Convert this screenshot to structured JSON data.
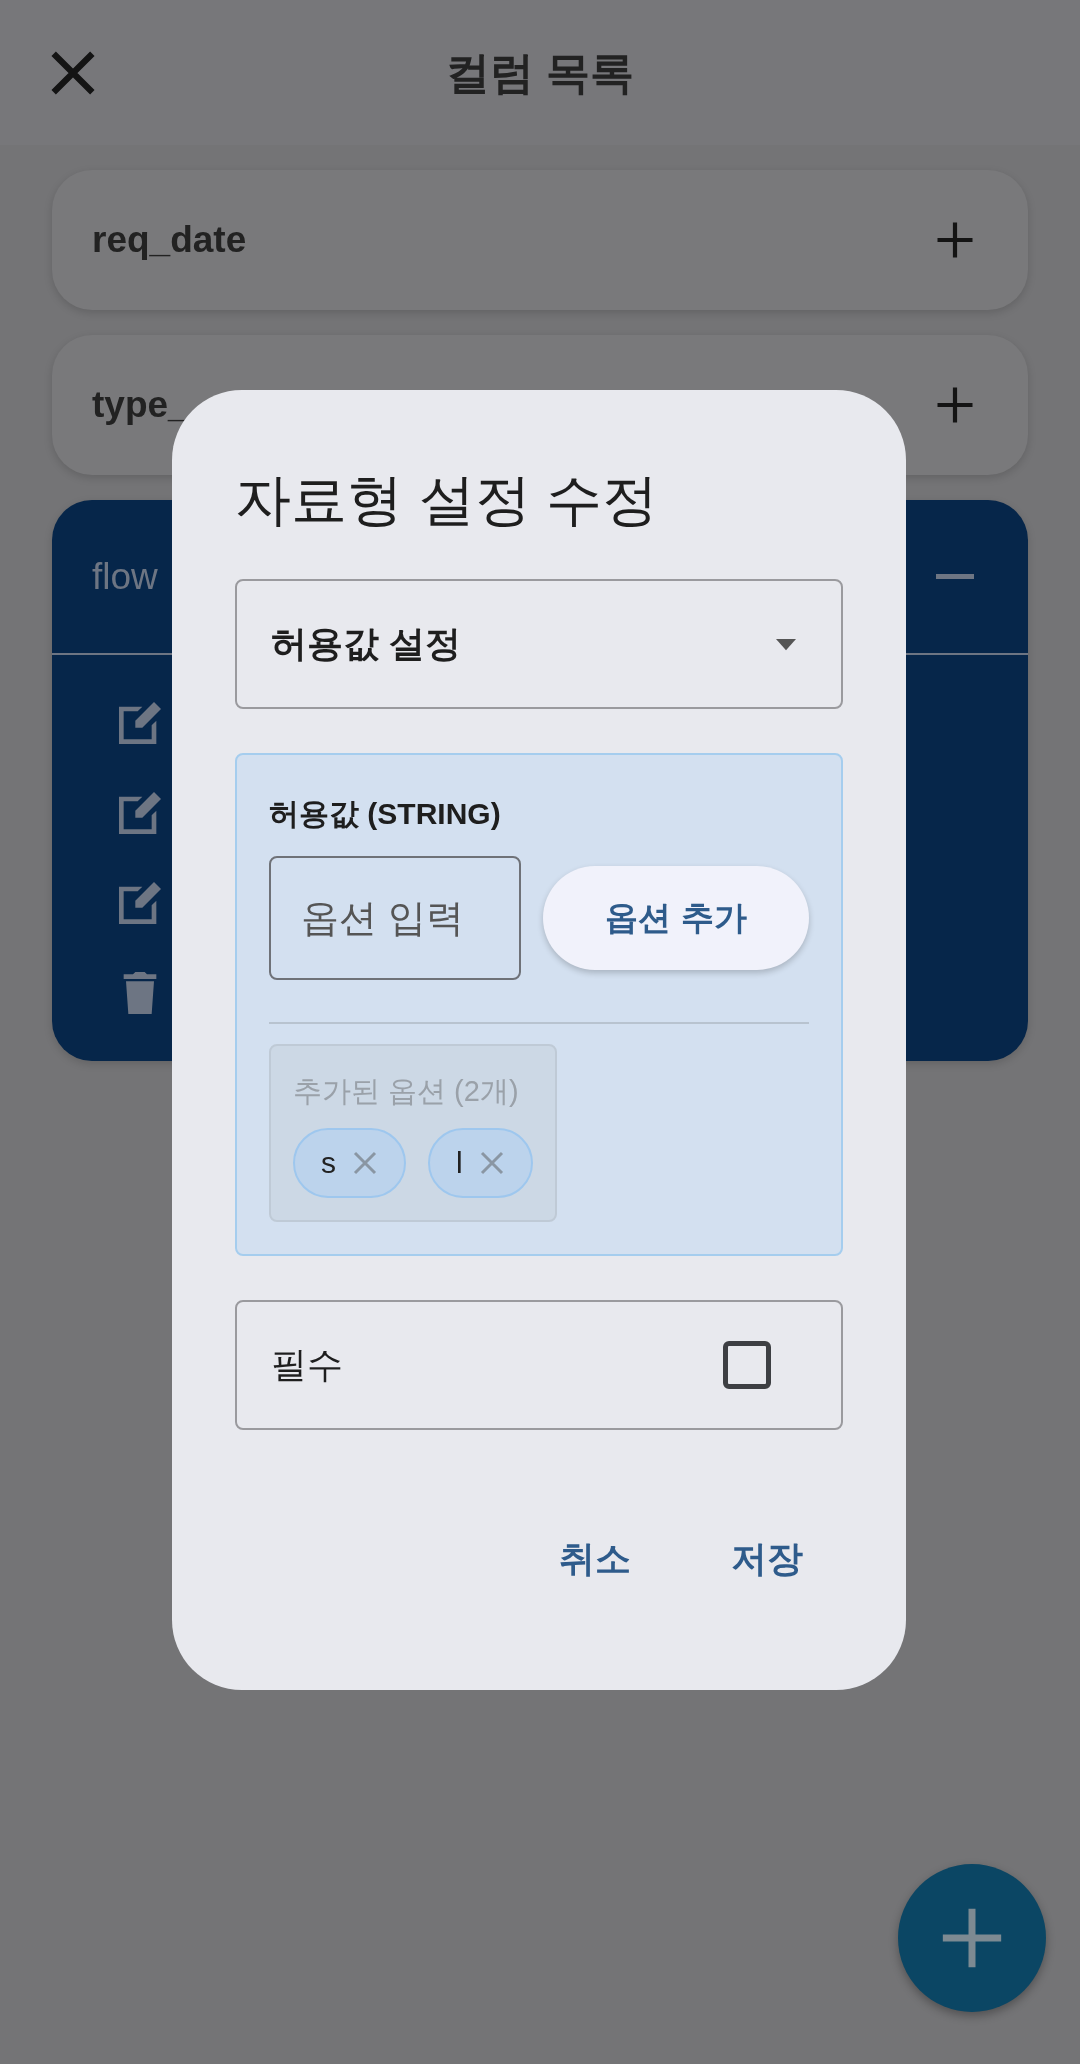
{
  "app_bar": {
    "title": "컬럼 목록"
  },
  "columns": [
    {
      "name": "req_date",
      "expanded": false
    },
    {
      "name": "type_",
      "expanded": false
    },
    {
      "name": "flow",
      "expanded": true,
      "actions": [
        {
          "kind": "edit"
        },
        {
          "kind": "edit"
        },
        {
          "kind": "edit"
        },
        {
          "kind": "delete"
        }
      ]
    }
  ],
  "dialog": {
    "title": "자료형 설정 수정",
    "dropdown": {
      "value": "허용값 설정"
    },
    "allowed": {
      "label": "허용값 (STRING)",
      "input": {
        "placeholder": "옵션 입력"
      },
      "add_button": "옵션 추가",
      "added_label": "추가된 옵션 (2개)",
      "chips": [
        {
          "label": "s"
        },
        {
          "label": "l"
        }
      ]
    },
    "required": {
      "label": "필수",
      "checked": false
    },
    "buttons": [
      "취소",
      "저장"
    ]
  }
}
